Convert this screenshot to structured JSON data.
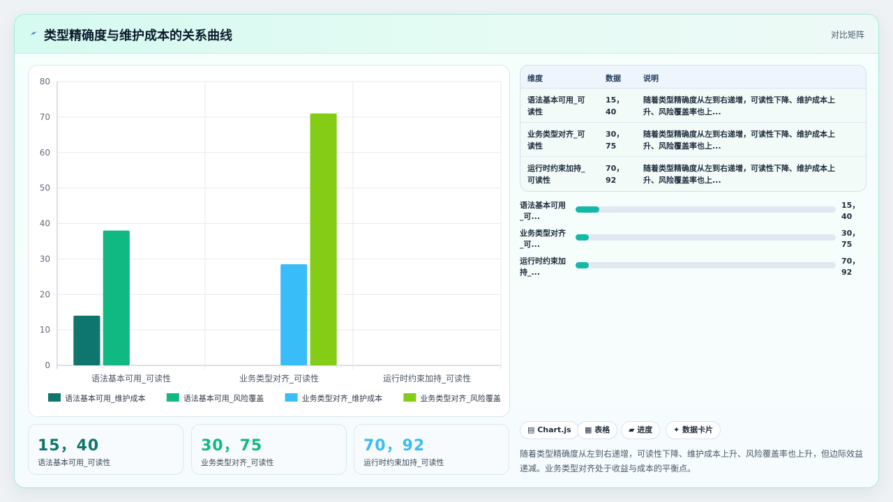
{
  "header": {
    "title": "类型精确度与维护成本的关系曲线",
    "link_label": "对比矩阵"
  },
  "colors": {
    "series": [
      "#0f766e",
      "#10b981",
      "#38bdf8",
      "#84cc16"
    ],
    "stat_values": [
      "#0f766e",
      "#10b981",
      "#38bdf8"
    ],
    "progress": "#14b8a6"
  },
  "chart_data": {
    "type": "bar",
    "categories": [
      "语法基本可用_可读性",
      "业务类型对齐_可读性",
      "运行时约束加持_可读性"
    ],
    "series": [
      {
        "name": "语法基本可用_维护成本",
        "values": [
          14,
          null,
          null
        ]
      },
      {
        "name": "语法基本可用_风险覆盖",
        "values": [
          38,
          null,
          null
        ]
      },
      {
        "name": "业务类型对齐_维护成本",
        "values": [
          null,
          28.5,
          null
        ]
      },
      {
        "name": "业务类型对齐_风险覆盖",
        "values": [
          null,
          71,
          null
        ]
      }
    ],
    "yticks": [
      "0",
      "10",
      "20",
      "30",
      "40",
      "50",
      "60",
      "70",
      "80"
    ],
    "ylim": [
      0,
      80
    ],
    "legend_position": "bottom",
    "grid": true
  },
  "stats": [
    {
      "value": "15，40",
      "label": "语法基本可用_可读性"
    },
    {
      "value": "30，75",
      "label": "业务类型对齐_可读性"
    },
    {
      "value": "70，92",
      "label": "运行时约束加持_可读性"
    }
  ],
  "table": {
    "headers": [
      "维度",
      "数据",
      "说明"
    ],
    "rows": [
      {
        "dim": [
          "语法基本可用_可",
          "读性"
        ],
        "data": [
          "15，",
          "40"
        ],
        "desc": [
          "随着类型精确度从左到右递增，可读性下降、维护成本上",
          "升、风险覆盖率也上..."
        ]
      },
      {
        "dim": [
          "业务类型对齐_可",
          "读性"
        ],
        "data": [
          "30，",
          "75"
        ],
        "desc": [
          "随着类型精确度从左到右递增，可读性下降、维护成本上",
          "升、风险覆盖率也上..."
        ]
      },
      {
        "dim": [
          "运行时约束加持_",
          "可读性"
        ],
        "data": [
          "70，",
          "92"
        ],
        "desc": [
          "随着类型精确度从左到右递增，可读性下降、维护成本上",
          "升、风险覆盖率也上..."
        ]
      }
    ]
  },
  "progress": [
    {
      "label": [
        "语法基本可用",
        "_可..."
      ],
      "value": [
        "15，",
        "40"
      ],
      "fraction": 0.09
    },
    {
      "label": [
        "业务类型对齐",
        "_可..."
      ],
      "value": [
        "30，",
        "75"
      ],
      "fraction": 0.05
    },
    {
      "label": [
        "运行时约束加",
        "持_..."
      ],
      "value": [
        "70，",
        "92"
      ],
      "fraction": 0.05
    }
  ],
  "chips": [
    "▤ Chart.js",
    "▦ 表格",
    "▰ 进度",
    "✦ 数据卡片"
  ],
  "summary": "随着类型精确度从左到右递增，可读性下降、维护成本上升、风险覆盖率也上升，但边际效益递减。业务类型对齐处于收益与成本的平衡点。"
}
